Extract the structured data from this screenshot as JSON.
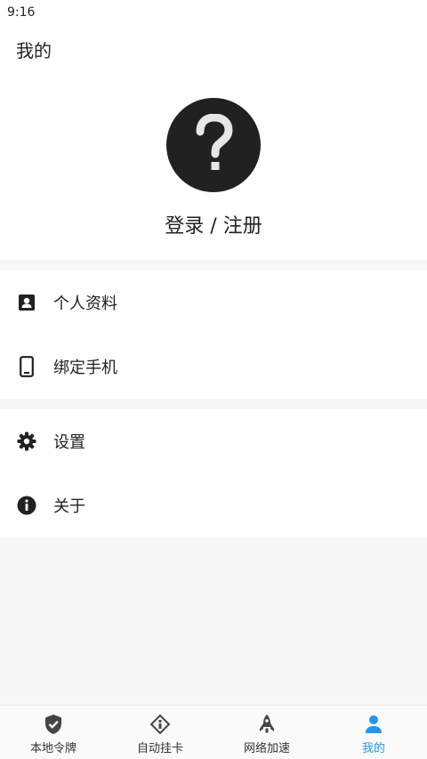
{
  "status_bar": {
    "time": "9:16"
  },
  "header": {
    "title": "我的"
  },
  "profile": {
    "avatar_icon": "question-mark-icon",
    "login_label": "登录 / 注册"
  },
  "menu_group1": [
    {
      "label": "个人资料",
      "icon": "contact-card-icon"
    },
    {
      "label": "绑定手机",
      "icon": "phone-icon"
    }
  ],
  "menu_group2": [
    {
      "label": "设置",
      "icon": "gear-icon"
    },
    {
      "label": "关于",
      "icon": "info-icon"
    }
  ],
  "tabbar": {
    "active_color": "#2196f3",
    "tabs": [
      {
        "label": "本地令牌",
        "icon": "shield-check-icon"
      },
      {
        "label": "自动挂卡",
        "icon": "diamond-card-icon"
      },
      {
        "label": "网络加速",
        "icon": "rocket-icon"
      },
      {
        "label": "我的",
        "icon": "person-icon",
        "active": true
      }
    ]
  }
}
